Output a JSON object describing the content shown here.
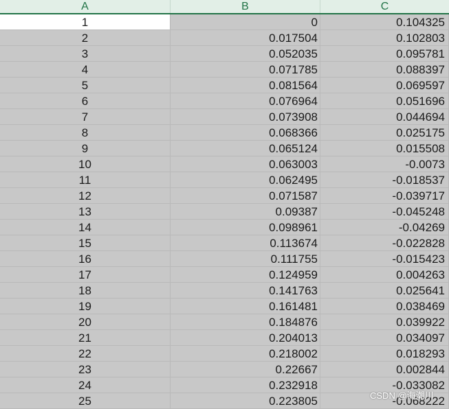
{
  "columns": [
    "A",
    "B",
    "C"
  ],
  "rows": [
    [
      "1",
      "0",
      "0.104325"
    ],
    [
      "2",
      "0.017504",
      "0.102803"
    ],
    [
      "3",
      "0.052035",
      "0.095781"
    ],
    [
      "4",
      "0.071785",
      "0.088397"
    ],
    [
      "5",
      "0.081564",
      "0.069597"
    ],
    [
      "6",
      "0.076964",
      "0.051696"
    ],
    [
      "7",
      "0.073908",
      "0.044694"
    ],
    [
      "8",
      "0.068366",
      "0.025175"
    ],
    [
      "9",
      "0.065124",
      "0.015508"
    ],
    [
      "10",
      "0.063003",
      "-0.0073"
    ],
    [
      "11",
      "0.062495",
      "-0.018537"
    ],
    [
      "12",
      "0.071587",
      "-0.039717"
    ],
    [
      "13",
      "0.09387",
      "-0.045248"
    ],
    [
      "14",
      "0.098961",
      "-0.04269"
    ],
    [
      "15",
      "0.113674",
      "-0.022828"
    ],
    [
      "16",
      "0.111755",
      "-0.015423"
    ],
    [
      "17",
      "0.124959",
      "0.004263"
    ],
    [
      "18",
      "0.141763",
      "0.025641"
    ],
    [
      "19",
      "0.161481",
      "0.038469"
    ],
    [
      "20",
      "0.184876",
      "0.039922"
    ],
    [
      "21",
      "0.204013",
      "0.034097"
    ],
    [
      "22",
      "0.218002",
      "0.018293"
    ],
    [
      "23",
      "0.22667",
      "0.002844"
    ],
    [
      "24",
      "0.232918",
      "-0.033082"
    ],
    [
      "25",
      "0.223805",
      "-0.068222"
    ]
  ],
  "watermark": "CSDN @海潮川"
}
